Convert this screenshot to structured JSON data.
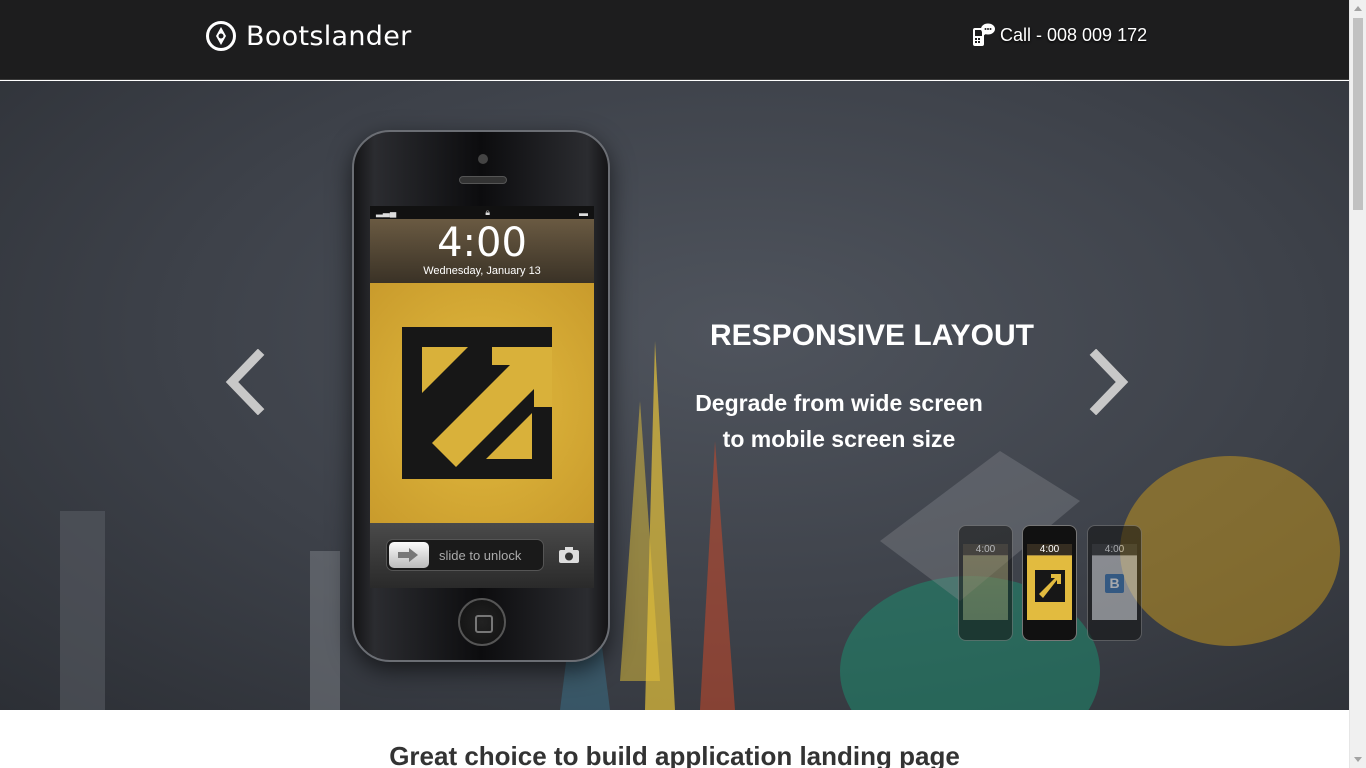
{
  "header": {
    "brand": "Bootslander",
    "call_text": "Call - 008 009 172",
    "icons": {
      "logo": "compass-logo-icon",
      "call": "phone-chat-icon"
    }
  },
  "hero": {
    "title": "RESPONSIVE LAYOUT",
    "subtitle_line1": "Degrade from wide screen",
    "subtitle_line2": "to mobile screen size",
    "nav": {
      "prev": "chevron-left-icon",
      "next": "chevron-right-icon"
    },
    "phone": {
      "time": "4:00",
      "date": "Wednesday, January 13",
      "unlock_text": "slide to unlock"
    },
    "thumbnails": [
      {
        "time": "4:00",
        "active": false
      },
      {
        "time": "4:00",
        "active": true
      },
      {
        "time": "4:00",
        "active": false,
        "badge": "B"
      }
    ]
  },
  "section": {
    "title": "Great choice to build application landing page"
  },
  "colors": {
    "header_bg": "#1d1d1e",
    "hero_bg": "#3d4149",
    "wallpaper": "#e2bb3f"
  }
}
